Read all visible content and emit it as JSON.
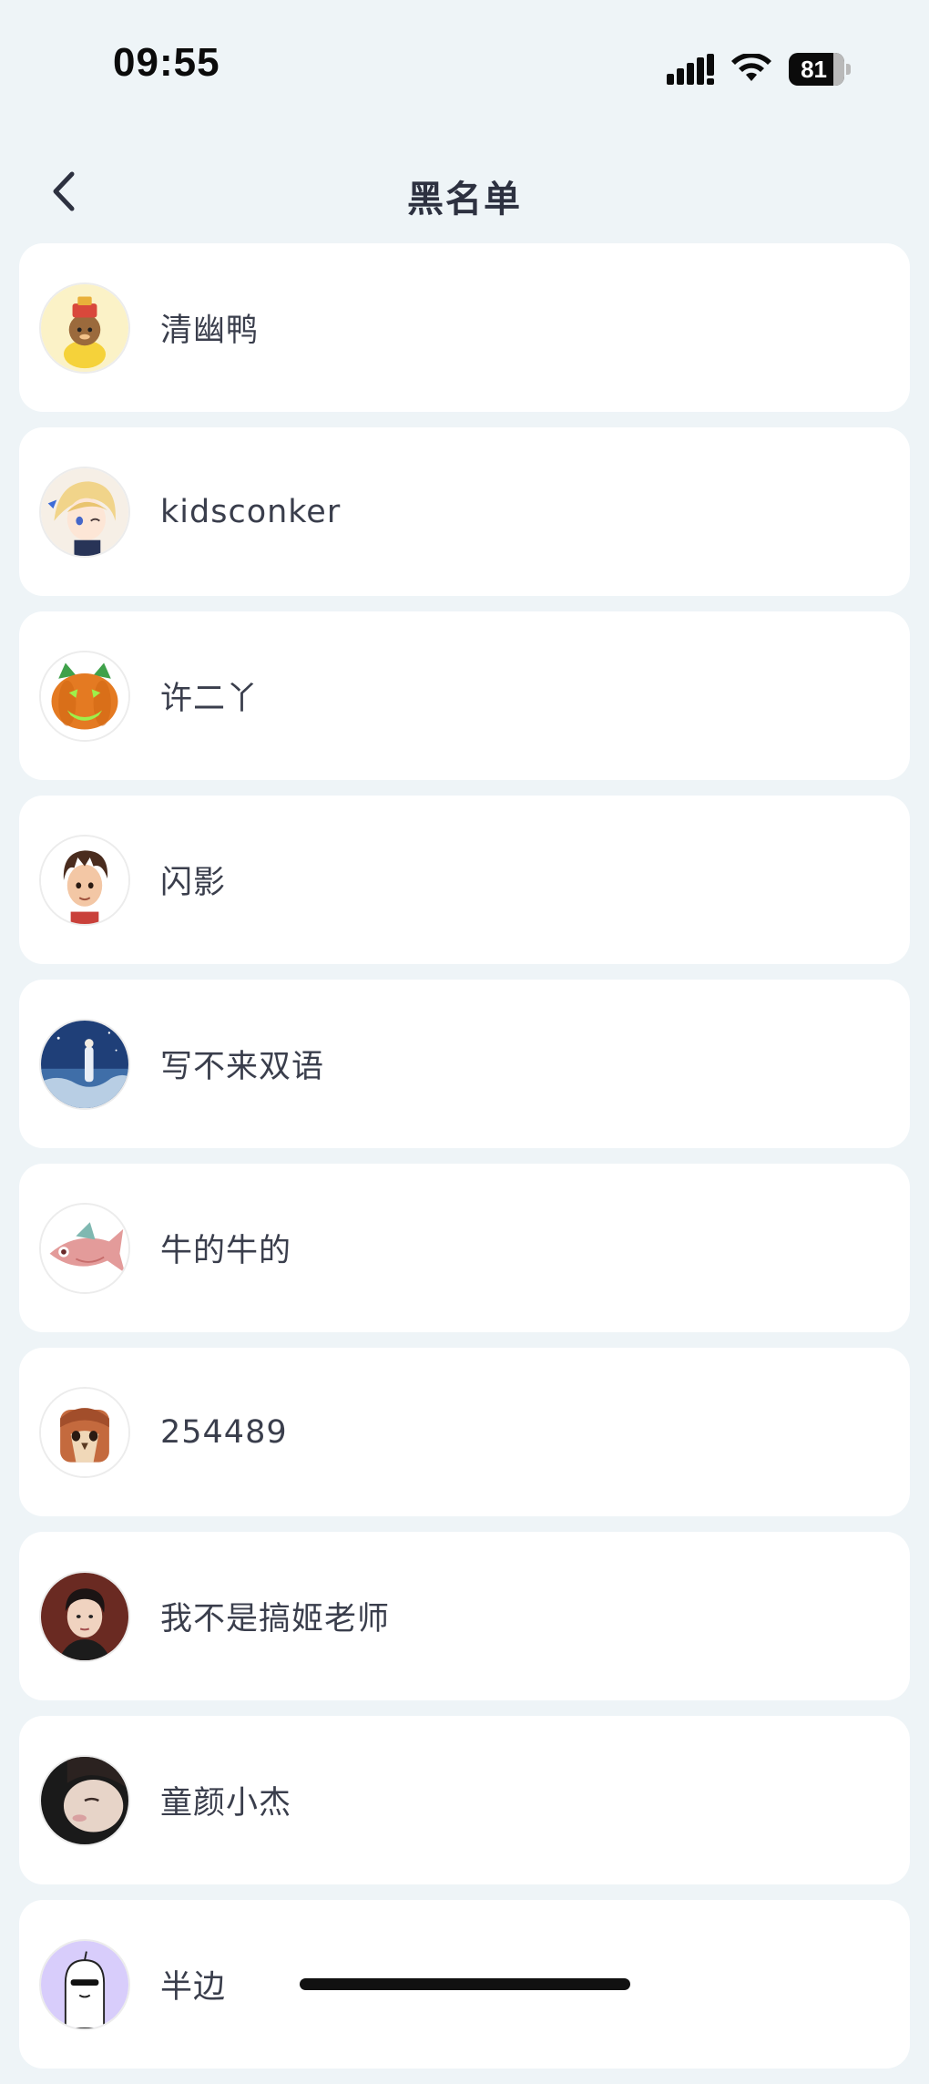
{
  "status_bar": {
    "time": "09:55",
    "battery_percent": "81",
    "battery_level": 0.81,
    "icons": [
      "signal-icon",
      "wifi-icon",
      "battery-icon"
    ]
  },
  "nav": {
    "title": "黑名单",
    "back_icon": "chevron-left-icon"
  },
  "blacklist": [
    {
      "name": "清幽鸭",
      "avatar": "cartoon-duck-avatar"
    },
    {
      "name": "kidsconker",
      "avatar": "anime-girl-avatar"
    },
    {
      "name": "许二丫",
      "avatar": "pumpkin-cat-avatar"
    },
    {
      "name": "闪影",
      "avatar": "3d-boy-avatar"
    },
    {
      "name": "写不来双语",
      "avatar": "night-sky-avatar"
    },
    {
      "name": "牛的牛的",
      "avatar": "fish-avatar"
    },
    {
      "name": "254489",
      "avatar": "owl-avatar"
    },
    {
      "name": "我不是搞姬老师",
      "avatar": "portrait-avatar"
    },
    {
      "name": "童颜小杰",
      "avatar": "photo-avatar"
    },
    {
      "name": "半边",
      "avatar": "ghost-sunglasses-avatar"
    }
  ],
  "colors": {
    "page_background": "#eef4f7",
    "card_background": "#ffffff",
    "text_primary": "#3a3e4c"
  }
}
